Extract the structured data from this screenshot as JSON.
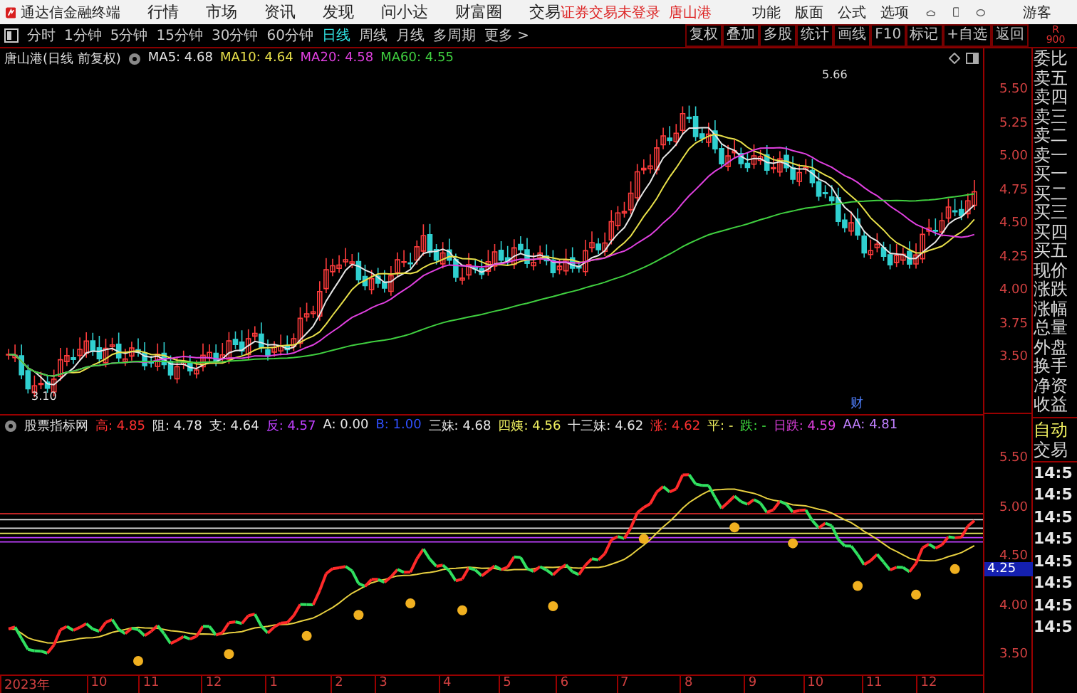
{
  "menu_bar": {
    "app_title": "通达信金融终端",
    "menus": [
      "行情",
      "市场",
      "资讯",
      "发现",
      "问小达",
      "财富圈",
      "交易"
    ],
    "login_status": "证券交易未登录",
    "stock_name": "唐山港",
    "right_menus": [
      "功能",
      "版面",
      "公式",
      "选项"
    ],
    "user": "游客"
  },
  "toolbar": {
    "periods": [
      {
        "label": "分时",
        "selected": false
      },
      {
        "label": "1分钟",
        "selected": false
      },
      {
        "label": "5分钟",
        "selected": false
      },
      {
        "label": "15分钟",
        "selected": false
      },
      {
        "label": "30分钟",
        "selected": false
      },
      {
        "label": "60分钟",
        "selected": false
      },
      {
        "label": "日线",
        "selected": true
      },
      {
        "label": "周线",
        "selected": false
      },
      {
        "label": "月线",
        "selected": false
      },
      {
        "label": "多周期",
        "selected": false
      },
      {
        "label": "更多 >",
        "selected": false
      }
    ],
    "actions": [
      "复权",
      "叠加",
      "多股",
      "统计",
      "画线",
      "F10",
      "标记",
      "+自选",
      "返回"
    ],
    "corner": [
      "R",
      "900"
    ]
  },
  "main_chart": {
    "title": "唐山港(日线 前复权)",
    "ma_legend": [
      {
        "text": "MA5: 4.68",
        "color": "#e6e6e6"
      },
      {
        "text": "MA10: 4.64",
        "color": "#e8e04a"
      },
      {
        "text": "MA20: 4.58",
        "color": "#e040e0"
      },
      {
        "text": "MA60: 4.55",
        "color": "#40d040"
      }
    ],
    "high_label": "5.66",
    "low_label": "3.10",
    "marker": "财",
    "price_axis": [
      "5.50",
      "5.25",
      "5.00",
      "4.75",
      "4.50",
      "4.25",
      "4.00",
      "3.75",
      "3.50"
    ]
  },
  "indicator": {
    "name": "股票指标网",
    "legend": [
      {
        "text": "高: 4.85",
        "color": "#ff3030"
      },
      {
        "text": "阻: 4.78",
        "color": "#e6e6e6"
      },
      {
        "text": "支: 4.64",
        "color": "#e6e6e6"
      },
      {
        "text": "反: 4.57",
        "color": "#c040ff"
      },
      {
        "text": "A: 0.00",
        "color": "#e6e6e6"
      },
      {
        "text": "B: 1.00",
        "color": "#3050ff"
      },
      {
        "text": "三妹: 4.68",
        "color": "#e6e6e6"
      },
      {
        "text": "四姨: 4.56",
        "color": "#f0f060"
      },
      {
        "text": "十三妹: 4.62",
        "color": "#e6e6e6"
      },
      {
        "text": "涨: 4.62",
        "color": "#ff3030"
      },
      {
        "text": "平: -",
        "color": "#f0f060"
      },
      {
        "text": "跌: -",
        "color": "#40e040"
      },
      {
        "text": "日跌: 4.59",
        "color": "#e040e0"
      },
      {
        "text": "AA: 4.81",
        "color": "#c080ff"
      }
    ],
    "price_axis": [
      "5.50",
      "5.00",
      "4.50",
      "4.00",
      "3.50"
    ],
    "current_price": "4.25"
  },
  "date_axis": [
    "2023年",
    "10",
    "11",
    "12",
    "1",
    "2",
    "3",
    "4",
    "5",
    "6",
    "7",
    "8",
    "9",
    "10",
    "11",
    "12"
  ],
  "quote_panel": {
    "labels": [
      "委比",
      "卖五",
      "卖四",
      "卖三",
      "卖二",
      "卖一",
      "买一",
      "买二",
      "买三",
      "买四",
      "买五",
      "现价",
      "涨跌",
      "涨幅",
      "总量",
      "外盘",
      "换手",
      "净资",
      "收益"
    ],
    "auto_trade": [
      "自动",
      "交易"
    ],
    "times": [
      "14:5",
      "14:5",
      "14:5",
      "14:5",
      "14:5",
      "14:5",
      "14:5",
      "14:5"
    ]
  }
}
